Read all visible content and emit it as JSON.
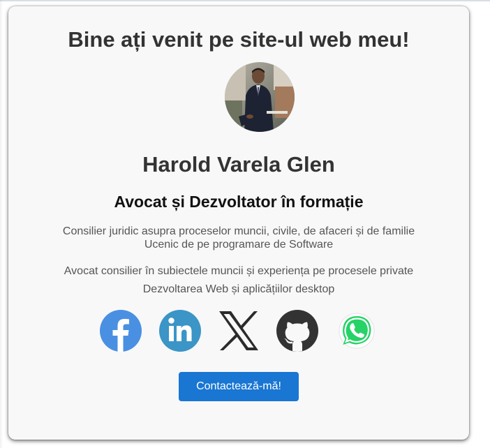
{
  "welcome_title": "Bine ați venit pe site-ul web meu!",
  "profile": {
    "name": "Harold Varela Glen",
    "role": "Avocat și Dezvoltator în formație",
    "description_lines": [
      "Consilier juridic asupra proceselor muncii, civile, de afaceri și de familie",
      "Ucenic de pe programare de Software"
    ],
    "summary_lines": [
      "Avocat consilier în subiectele muncii și experiența pe procesele private",
      "Dezvoltarea Web și aplicățiilor desktop"
    ]
  },
  "social_links": [
    {
      "icon": "facebook-icon",
      "color": "#4a90e2"
    },
    {
      "icon": "linkedin-icon",
      "color": "#3b95c6"
    },
    {
      "icon": "x-icon",
      "color": "#2b2b2b"
    },
    {
      "icon": "github-icon",
      "color": "#333333"
    },
    {
      "icon": "whatsapp-icon",
      "color": "#25d366"
    }
  ],
  "contact_button": {
    "label": "Contactează-mă!",
    "color": "#1976d2"
  }
}
